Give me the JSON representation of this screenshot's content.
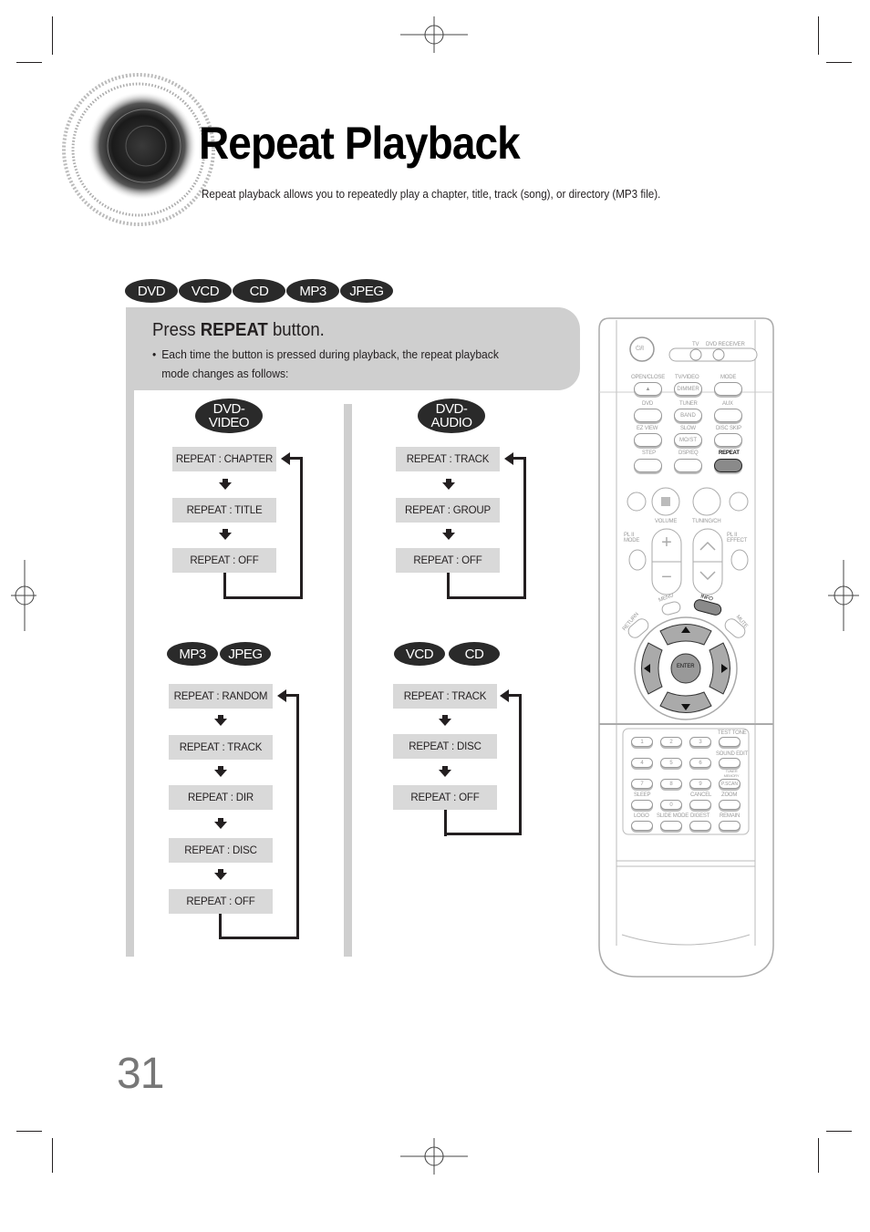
{
  "page": {
    "title": "Repeat Playback",
    "subtitle": "Repeat playback allows you to repeatedly play a chapter, title, track (song), or directory (MP3 file).",
    "page_number": "31"
  },
  "disc_badges": [
    "DVD",
    "VCD",
    "CD",
    "MP3",
    "JPEG"
  ],
  "instruction": {
    "title_prefix": "Press ",
    "title_bold": "REPEAT",
    "title_suffix": " button.",
    "bullet_symbol": "•",
    "bullet_text": "Each time the button is pressed during playback, the repeat playback mode changes as follows:"
  },
  "flows": [
    {
      "id": "dvd-video",
      "badges": [
        "DVD-\nVIDEO"
      ],
      "badge_lines": [
        "DVD-",
        "VIDEO"
      ],
      "steps": [
        "REPEAT : CHAPTER",
        "REPEAT : TITLE",
        "REPEAT : OFF"
      ]
    },
    {
      "id": "dvd-audio",
      "badge_lines": [
        "DVD-",
        "AUDIO"
      ],
      "steps": [
        "REPEAT : TRACK",
        "REPEAT : GROUP",
        "REPEAT : OFF"
      ]
    },
    {
      "id": "mp3-jpeg",
      "badges": [
        "MP3",
        "JPEG"
      ],
      "steps": [
        "REPEAT : RANDOM",
        "REPEAT : TRACK",
        "REPEAT : DIR",
        "REPEAT : DISC",
        "REPEAT : OFF"
      ]
    },
    {
      "id": "vcd-cd",
      "badges": [
        "VCD",
        "CD"
      ],
      "steps": [
        "REPEAT : TRACK",
        "REPEAT : DISC",
        "REPEAT : OFF"
      ]
    }
  ],
  "remote": {
    "power_label": "⏻/I",
    "labels": {
      "tv": "TV",
      "dvd_receiver": "DVD RECEIVER",
      "open_close": "OPEN/CLOSE",
      "tv_video": "TV/VIDEO",
      "mode": "MODE",
      "dimmer": "DIMMER",
      "dvd": "DVD",
      "tuner": "TUNER",
      "aux": "AUX",
      "band": "BAND",
      "ez_view": "EZ VIEW",
      "slow": "SLOW",
      "disc_skip": "DISC SKIP",
      "mo_st": "MO/ST",
      "step": "STEP",
      "dsp_eq": "DSP/EQ",
      "repeat": "REPEAT",
      "volume": "VOLUME",
      "tuning_ch": "TUNING/CH",
      "pl2_mode": "PL II MODE",
      "pl2_effect": "PL II EFFECT",
      "menu": "MENU",
      "info": "INFO",
      "return": "RETURN",
      "mute": "MUTE",
      "enter": "ENTER",
      "test_tone": "TEST TONE",
      "sound_edit": "SOUND EDIT",
      "tuner_memory": "TUNER MEMORY",
      "p_scan": "P.SCAN",
      "sleep": "SLEEP",
      "cancel": "CANCEL",
      "zoom": "ZOOM",
      "logo": "LOGO",
      "slide_mode": "SLIDE MODE",
      "digest": "DIGEST",
      "remain": "REMAIN"
    },
    "digits": [
      "1",
      "2",
      "3",
      "4",
      "5",
      "6",
      "7",
      "8",
      "9",
      "0"
    ],
    "highlighted_button": "REPEAT"
  },
  "colors": {
    "badge_bg": "#2a2a2a",
    "panel_bg": "#cfcfcf",
    "mode_box_bg": "#d9d9d9",
    "line": "#231f20",
    "page_number": "#777777"
  }
}
